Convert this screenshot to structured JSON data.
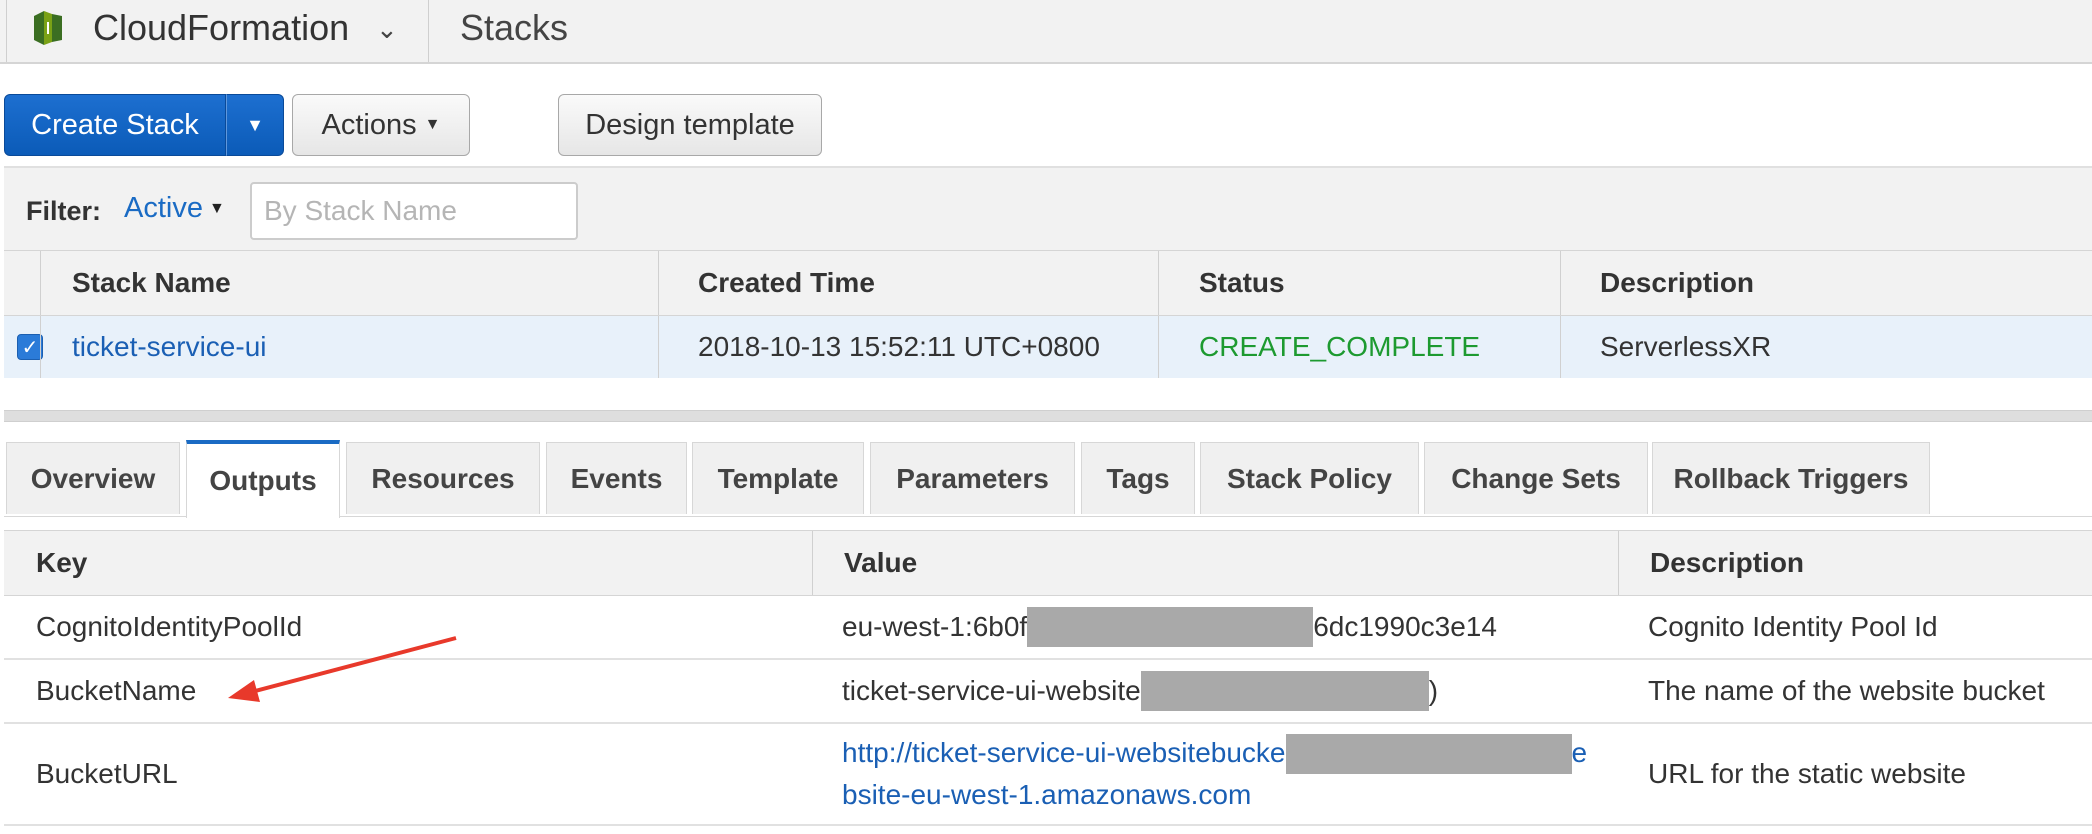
{
  "header": {
    "service_name": "CloudFormation",
    "page_title": "Stacks",
    "logo_icon": "cloudformation-logo-icon",
    "colors": {
      "logo_dark": "#3b6e22",
      "logo_light": "#7aa116"
    }
  },
  "toolbar": {
    "create_stack_label": "Create Stack",
    "actions_label": "Actions",
    "design_template_label": "Design template",
    "accent": "#1466c8"
  },
  "filter": {
    "label": "Filter:",
    "selected": "Active",
    "search_placeholder": "By Stack Name"
  },
  "stacks": {
    "headers": [
      "Stack Name",
      "Created Time",
      "Status",
      "Description"
    ],
    "rows": [
      {
        "selected": true,
        "name": "ticket-service-ui",
        "created": "2018-10-13 15:52:11 UTC+0800",
        "status": "CREATE_COMPLETE",
        "description": "ServerlessXR"
      }
    ],
    "status_color": "#1d9a30"
  },
  "tabs": [
    {
      "label": "Overview",
      "active": false
    },
    {
      "label": "Outputs",
      "active": true
    },
    {
      "label": "Resources",
      "active": false
    },
    {
      "label": "Events",
      "active": false
    },
    {
      "label": "Template",
      "active": false
    },
    {
      "label": "Parameters",
      "active": false
    },
    {
      "label": "Tags",
      "active": false
    },
    {
      "label": "Stack Policy",
      "active": false
    },
    {
      "label": "Change Sets",
      "active": false
    },
    {
      "label": "Rollback Triggers",
      "active": false
    }
  ],
  "outputs": {
    "headers": [
      "Key",
      "Value",
      "Description"
    ],
    "rows": [
      {
        "key": "CognitoIdentityPoolId",
        "value_start": "eu-west-1:6b0f",
        "value_end": "6dc1990c3e14",
        "description": "Cognito Identity Pool Id"
      },
      {
        "key": "BucketName",
        "value_start": "ticket-service-ui-website",
        "value_end": ")",
        "description": "The name of the website bucket"
      },
      {
        "key": "BucketURL",
        "value_start": "http://ticket-service-ui-websitebucke",
        "value_end": "e",
        "value_line2": "bsite-eu-west-1.amazonaws.com",
        "description": "URL for the static website"
      }
    ]
  },
  "annotation": {
    "arrow_color": "#e8392b"
  }
}
